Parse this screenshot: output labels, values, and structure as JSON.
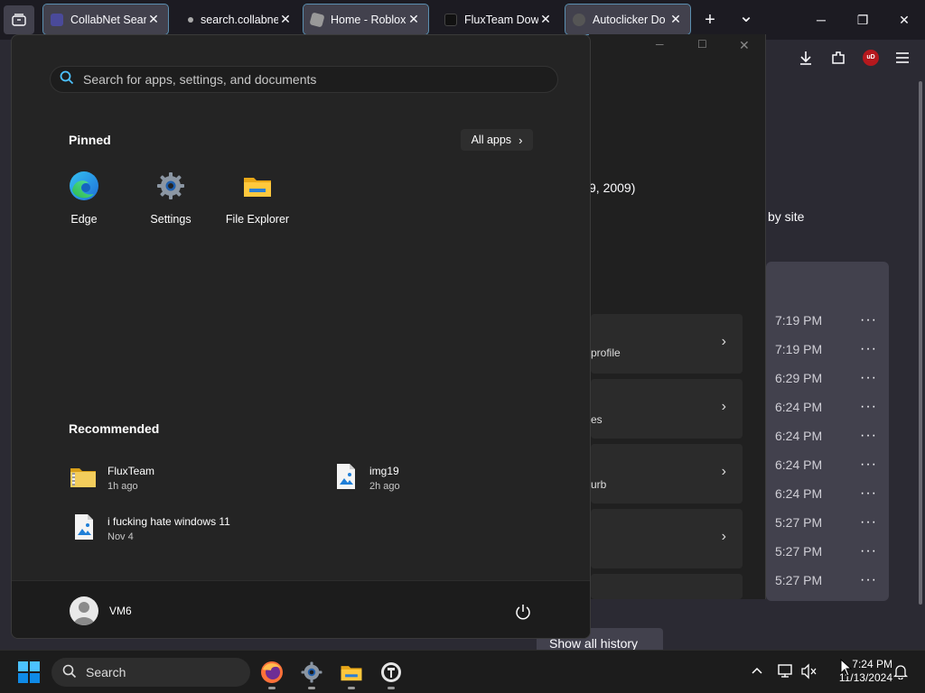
{
  "browser": {
    "tabs": [
      {
        "title": "CollabNet Search",
        "favicon_color": "#4a4a9a",
        "active": true
      },
      {
        "title": "search.collabnet",
        "favicon_color": "#333",
        "active": false
      },
      {
        "title": "Home - Roblox",
        "favicon_color": "#888",
        "active": true
      },
      {
        "title": "FluxTeam Down",
        "favicon_color": "#222",
        "active": false
      },
      {
        "title": "Autoclicker Do",
        "favicon_color": "#555",
        "active": true
      }
    ],
    "new_tab": "+",
    "tab_list": "⌄",
    "win_minimize": "─",
    "win_restore": "❐",
    "win_close": "✕",
    "toolbar_icons": [
      "download-icon",
      "extensions-icon",
      "ublock-icon",
      "menu-icon"
    ],
    "ublock_label": "uD"
  },
  "history_page": {
    "date_fragment": "9, 2009)",
    "by_site": "by site",
    "times": [
      "7:19 PM",
      "7:19 PM",
      "6:29 PM",
      "6:24 PM",
      "6:24 PM",
      "6:24 PM",
      "6:24 PM",
      "5:27 PM",
      "5:27 PM",
      "5:27 PM"
    ],
    "more": "···",
    "show_all": "Show all history"
  },
  "settings_window": {
    "cards": [
      {
        "text": "profile"
      },
      {
        "text": "es"
      },
      {
        "text": "urb"
      },
      {
        "text": ""
      },
      {
        "text": ""
      }
    ]
  },
  "start_menu": {
    "search_placeholder": "Search for apps, settings, and documents",
    "pinned_title": "Pinned",
    "all_apps": "All apps",
    "pinned": [
      {
        "label": "Edge",
        "icon": "edge-icon"
      },
      {
        "label": "Settings",
        "icon": "settings-icon"
      },
      {
        "label": "File Explorer",
        "icon": "file-explorer-icon"
      }
    ],
    "recommended_title": "Recommended",
    "recommended": [
      {
        "name": "FluxTeam",
        "time": "1h ago",
        "icon": "zip-folder-icon"
      },
      {
        "name": "img19",
        "time": "2h ago",
        "icon": "image-file-icon"
      },
      {
        "name": "i fucking hate windows 11",
        "time": "Nov 4",
        "icon": "image-file-icon"
      }
    ],
    "user": "VM6"
  },
  "taskbar": {
    "search_label": "Search",
    "time": "7:24 PM",
    "date": "11/13/2024",
    "icons": [
      "start-icon",
      "firefox-icon",
      "settings-icon",
      "file-explorer-icon",
      "app-icon"
    ]
  }
}
